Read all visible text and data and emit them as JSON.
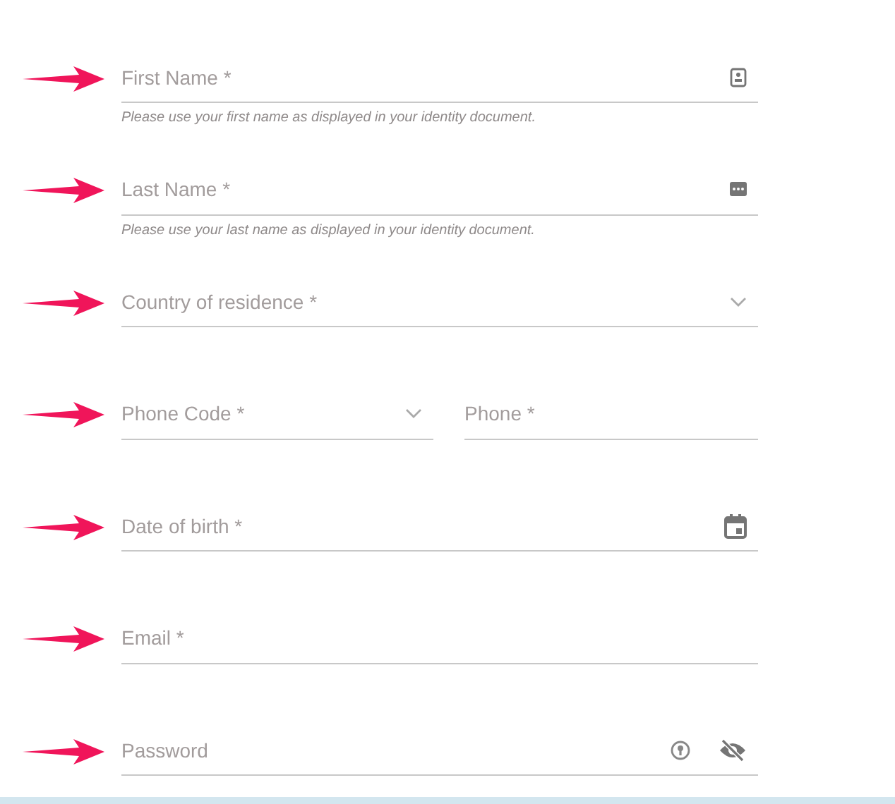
{
  "fields": [
    {
      "kind": "text",
      "placeholder": "First Name *",
      "helper": "Please use your first name as displayed in your identity document."
    },
    {
      "kind": "text",
      "placeholder": "Last Name *",
      "helper": "Please use your last name as displayed in your identity document."
    },
    {
      "kind": "select",
      "placeholder": "Country of residence *"
    },
    {
      "kind": "phone",
      "code_placeholder": "Phone Code *",
      "placeholder": "Phone *"
    },
    {
      "kind": "date",
      "placeholder": "Date of birth *"
    },
    {
      "kind": "text",
      "placeholder": "Email *"
    },
    {
      "kind": "password",
      "placeholder": "Password"
    }
  ]
}
